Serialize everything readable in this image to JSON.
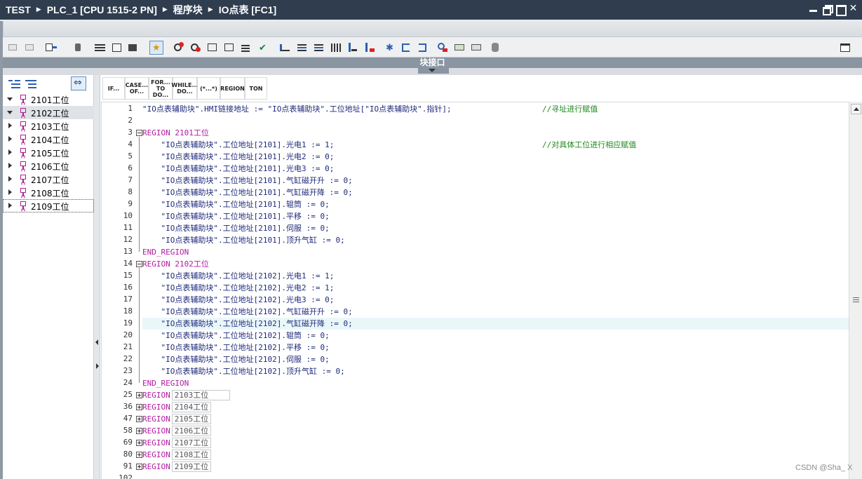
{
  "titlebar": {
    "breadcrumbs": [
      "TEST",
      "PLC_1 [CPU 1515-2 PN]",
      "程序块",
      "IO点表 [FC1]"
    ]
  },
  "interface_bar": {
    "label": "块接口"
  },
  "left_tree": {
    "items": [
      {
        "label": "2101工位",
        "expanded": true
      },
      {
        "label": "2102工位",
        "expanded": true
      },
      {
        "label": "2103工位",
        "expanded": false
      },
      {
        "label": "2104工位",
        "expanded": false
      },
      {
        "label": "2105工位",
        "expanded": false
      },
      {
        "label": "2106工位",
        "expanded": false
      },
      {
        "label": "2107工位",
        "expanded": false
      },
      {
        "label": "2108工位",
        "expanded": false
      },
      {
        "label": "2109工位",
        "expanded": false
      }
    ]
  },
  "instructions": [
    {
      "label": "IF..."
    },
    {
      "label": "CASE... OF..."
    },
    {
      "label": "FOR... TO DO..."
    },
    {
      "label": "WHILE... DO..."
    },
    {
      "label": "(*...*)"
    },
    {
      "label": "REGION"
    },
    {
      "label": "TON"
    }
  ],
  "code": {
    "lines": [
      {
        "n": "1",
        "code": "\"IO点表辅助块\".HMI链接地址 := \"IO点表辅助块\".工位地址[\"IO点表辅助块\".指针];",
        "comment": "//寻址进行赋值"
      },
      {
        "n": "2",
        "code": ""
      },
      {
        "n": "3",
        "code": "REGION 2101工位",
        "kw": true
      },
      {
        "n": "4",
        "code": "    \"IO点表辅助块\".工位地址[2101].光电1 := 1;",
        "comment": "//对具体工位进行相应赋值"
      },
      {
        "n": "5",
        "code": "    \"IO点表辅助块\".工位地址[2101].光电2 := 0;"
      },
      {
        "n": "6",
        "code": "    \"IO点表辅助块\".工位地址[2101].光电3 := 0;"
      },
      {
        "n": "7",
        "code": "    \"IO点表辅助块\".工位地址[2101].气缸磁开升 := 0;"
      },
      {
        "n": "8",
        "code": "    \"IO点表辅助块\".工位地址[2101].气缸磁开降 := 0;"
      },
      {
        "n": "9",
        "code": "    \"IO点表辅助块\".工位地址[2101].辊筒 := 0;"
      },
      {
        "n": "10",
        "code": "    \"IO点表辅助块\".工位地址[2101].平移 := 0;"
      },
      {
        "n": "11",
        "code": "    \"IO点表辅助块\".工位地址[2101].伺服 := 0;"
      },
      {
        "n": "12",
        "code": "    \"IO点表辅助块\".工位地址[2101].顶升气缸 := 0;"
      },
      {
        "n": "13",
        "code": "END_REGION",
        "kw": true
      },
      {
        "n": "14",
        "code": "REGION 2102工位",
        "kw": true
      },
      {
        "n": "15",
        "code": "    \"IO点表辅助块\".工位地址[2102].光电1 := 1;"
      },
      {
        "n": "16",
        "code": "    \"IO点表辅助块\".工位地址[2102].光电2 := 1;"
      },
      {
        "n": "17",
        "code": "    \"IO点表辅助块\".工位地址[2102].光电3 := 0;"
      },
      {
        "n": "18",
        "code": "    \"IO点表辅助块\".工位地址[2102].气缸磁开升 := 0;"
      },
      {
        "n": "19",
        "code": "    \"IO点表辅助块\".工位地址[2102].气缸磁开降 := 0;"
      },
      {
        "n": "20",
        "code": "    \"IO点表辅助块\".工位地址[2102].辊筒 := 0;"
      },
      {
        "n": "21",
        "code": "    \"IO点表辅助块\".工位地址[2102].平移 := 0;"
      },
      {
        "n": "22",
        "code": "    \"IO点表辅助块\".工位地址[2102].伺服 := 0;"
      },
      {
        "n": "23",
        "code": "    \"IO点表辅助块\".工位地址[2102].顶升气缸 := 0;"
      },
      {
        "n": "24",
        "code": "END_REGION",
        "kw": true
      },
      {
        "n": "25",
        "code": "REGION",
        "kw": true,
        "box": "2103工位"
      },
      {
        "n": "36",
        "code": "REGION",
        "kw": true,
        "box": "2104工位"
      },
      {
        "n": "47",
        "code": "REGION",
        "kw": true,
        "box": "2105工位"
      },
      {
        "n": "58",
        "code": "REGION",
        "kw": true,
        "box": "2106工位"
      },
      {
        "n": "69",
        "code": "REGION",
        "kw": true,
        "box": "2107工位"
      },
      {
        "n": "80",
        "code": "REGION",
        "kw": true,
        "box": "2108工位"
      },
      {
        "n": "91",
        "code": "REGION",
        "kw": true,
        "box": "2109工位"
      },
      {
        "n": "102",
        "code": ""
      }
    ]
  },
  "watermark": "CSDN @Sha_ X"
}
